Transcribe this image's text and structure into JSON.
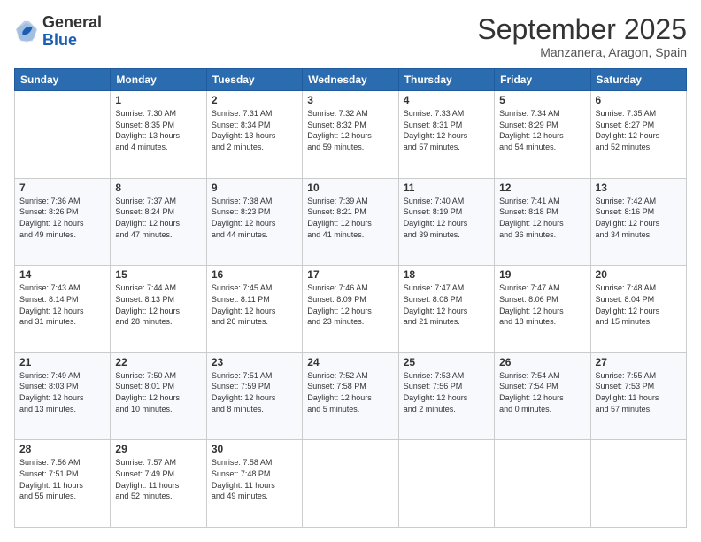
{
  "header": {
    "logo": {
      "line1": "General",
      "line2": "Blue"
    },
    "title": "September 2025",
    "location": "Manzanera, Aragon, Spain"
  },
  "weekdays": [
    "Sunday",
    "Monday",
    "Tuesday",
    "Wednesday",
    "Thursday",
    "Friday",
    "Saturday"
  ],
  "weeks": [
    [
      {
        "day": "",
        "info": ""
      },
      {
        "day": "1",
        "info": "Sunrise: 7:30 AM\nSunset: 8:35 PM\nDaylight: 13 hours\nand 4 minutes."
      },
      {
        "day": "2",
        "info": "Sunrise: 7:31 AM\nSunset: 8:34 PM\nDaylight: 13 hours\nand 2 minutes."
      },
      {
        "day": "3",
        "info": "Sunrise: 7:32 AM\nSunset: 8:32 PM\nDaylight: 12 hours\nand 59 minutes."
      },
      {
        "day": "4",
        "info": "Sunrise: 7:33 AM\nSunset: 8:31 PM\nDaylight: 12 hours\nand 57 minutes."
      },
      {
        "day": "5",
        "info": "Sunrise: 7:34 AM\nSunset: 8:29 PM\nDaylight: 12 hours\nand 54 minutes."
      },
      {
        "day": "6",
        "info": "Sunrise: 7:35 AM\nSunset: 8:27 PM\nDaylight: 12 hours\nand 52 minutes."
      }
    ],
    [
      {
        "day": "7",
        "info": "Sunrise: 7:36 AM\nSunset: 8:26 PM\nDaylight: 12 hours\nand 49 minutes."
      },
      {
        "day": "8",
        "info": "Sunrise: 7:37 AM\nSunset: 8:24 PM\nDaylight: 12 hours\nand 47 minutes."
      },
      {
        "day": "9",
        "info": "Sunrise: 7:38 AM\nSunset: 8:23 PM\nDaylight: 12 hours\nand 44 minutes."
      },
      {
        "day": "10",
        "info": "Sunrise: 7:39 AM\nSunset: 8:21 PM\nDaylight: 12 hours\nand 41 minutes."
      },
      {
        "day": "11",
        "info": "Sunrise: 7:40 AM\nSunset: 8:19 PM\nDaylight: 12 hours\nand 39 minutes."
      },
      {
        "day": "12",
        "info": "Sunrise: 7:41 AM\nSunset: 8:18 PM\nDaylight: 12 hours\nand 36 minutes."
      },
      {
        "day": "13",
        "info": "Sunrise: 7:42 AM\nSunset: 8:16 PM\nDaylight: 12 hours\nand 34 minutes."
      }
    ],
    [
      {
        "day": "14",
        "info": "Sunrise: 7:43 AM\nSunset: 8:14 PM\nDaylight: 12 hours\nand 31 minutes."
      },
      {
        "day": "15",
        "info": "Sunrise: 7:44 AM\nSunset: 8:13 PM\nDaylight: 12 hours\nand 28 minutes."
      },
      {
        "day": "16",
        "info": "Sunrise: 7:45 AM\nSunset: 8:11 PM\nDaylight: 12 hours\nand 26 minutes."
      },
      {
        "day": "17",
        "info": "Sunrise: 7:46 AM\nSunset: 8:09 PM\nDaylight: 12 hours\nand 23 minutes."
      },
      {
        "day": "18",
        "info": "Sunrise: 7:47 AM\nSunset: 8:08 PM\nDaylight: 12 hours\nand 21 minutes."
      },
      {
        "day": "19",
        "info": "Sunrise: 7:47 AM\nSunset: 8:06 PM\nDaylight: 12 hours\nand 18 minutes."
      },
      {
        "day": "20",
        "info": "Sunrise: 7:48 AM\nSunset: 8:04 PM\nDaylight: 12 hours\nand 15 minutes."
      }
    ],
    [
      {
        "day": "21",
        "info": "Sunrise: 7:49 AM\nSunset: 8:03 PM\nDaylight: 12 hours\nand 13 minutes."
      },
      {
        "day": "22",
        "info": "Sunrise: 7:50 AM\nSunset: 8:01 PM\nDaylight: 12 hours\nand 10 minutes."
      },
      {
        "day": "23",
        "info": "Sunrise: 7:51 AM\nSunset: 7:59 PM\nDaylight: 12 hours\nand 8 minutes."
      },
      {
        "day": "24",
        "info": "Sunrise: 7:52 AM\nSunset: 7:58 PM\nDaylight: 12 hours\nand 5 minutes."
      },
      {
        "day": "25",
        "info": "Sunrise: 7:53 AM\nSunset: 7:56 PM\nDaylight: 12 hours\nand 2 minutes."
      },
      {
        "day": "26",
        "info": "Sunrise: 7:54 AM\nSunset: 7:54 PM\nDaylight: 12 hours\nand 0 minutes."
      },
      {
        "day": "27",
        "info": "Sunrise: 7:55 AM\nSunset: 7:53 PM\nDaylight: 11 hours\nand 57 minutes."
      }
    ],
    [
      {
        "day": "28",
        "info": "Sunrise: 7:56 AM\nSunset: 7:51 PM\nDaylight: 11 hours\nand 55 minutes."
      },
      {
        "day": "29",
        "info": "Sunrise: 7:57 AM\nSunset: 7:49 PM\nDaylight: 11 hours\nand 52 minutes."
      },
      {
        "day": "30",
        "info": "Sunrise: 7:58 AM\nSunset: 7:48 PM\nDaylight: 11 hours\nand 49 minutes."
      },
      {
        "day": "",
        "info": ""
      },
      {
        "day": "",
        "info": ""
      },
      {
        "day": "",
        "info": ""
      },
      {
        "day": "",
        "info": ""
      }
    ]
  ]
}
